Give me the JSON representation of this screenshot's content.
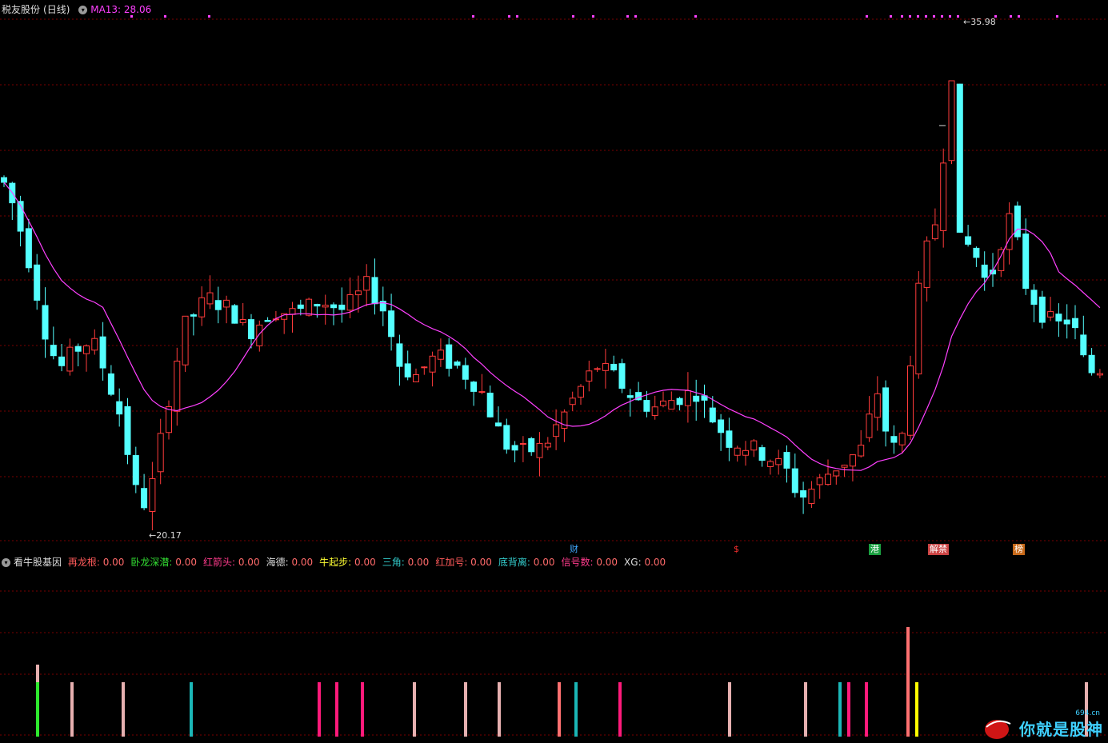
{
  "main": {
    "stock_name": "税友股份",
    "period": "(日线)",
    "ma_label": "MA13: 28.06",
    "high_label": "35.98",
    "low_label": "20.17",
    "event_tags": [
      {
        "text": "财",
        "color": "#3fa9ff",
        "bg": "#000"
      },
      {
        "text": "$",
        "color": "#ff3030",
        "bg": "#000"
      },
      {
        "text": "港",
        "color": "#fff",
        "bg": "#1aa040"
      },
      {
        "text": "解禁",
        "color": "#fff",
        "bg": "#c44"
      },
      {
        "text": "榜",
        "color": "#fff",
        "bg": "#c86a1a"
      }
    ],
    "colors": {
      "up": "#ff3b3b",
      "down": "#54ffff",
      "ma": "#ff40ff",
      "grid": "#7a0000",
      "signal_dot": "#ff40ff"
    }
  },
  "indicator": {
    "name": "看牛股基因",
    "items": [
      {
        "label": "再龙根: ",
        "value": "0.00",
        "color": "#ff5a5a"
      },
      {
        "label": "卧龙深潜: ",
        "value": "0.00",
        "color": "#33dd33"
      },
      {
        "label": "红箭头: ",
        "value": "0.00",
        "color": "#ff3b8c"
      },
      {
        "label": "海德: ",
        "value": "0.00",
        "color": "#dddddd"
      },
      {
        "label": "牛起步: ",
        "value": "0.00",
        "color": "#ffff33"
      },
      {
        "label": "三角: ",
        "value": "0.00",
        "color": "#33cccc"
      },
      {
        "label": "红加号: ",
        "value": "0.00",
        "color": "#ff5a5a"
      },
      {
        "label": "底背离: ",
        "value": "0.00",
        "color": "#33cccc"
      },
      {
        "label": "信号数: ",
        "value": "0.00",
        "color": "#ff3b8c"
      },
      {
        "label": "XG: ",
        "value": "0.00",
        "color": "#dddddd"
      }
    ]
  },
  "logo": {
    "text": "你就是股神",
    "site": "694.cn"
  }
}
